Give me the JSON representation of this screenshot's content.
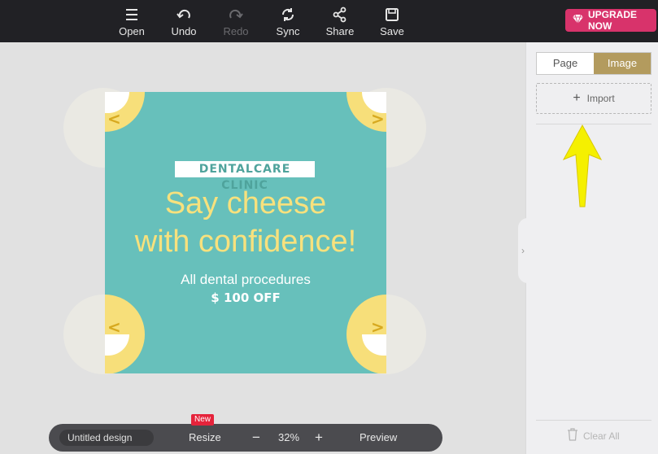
{
  "toolbar": {
    "open_label": "Open",
    "undo_label": "Undo",
    "redo_label": "Redo",
    "sync_label": "Sync",
    "share_label": "Share",
    "save_label": "Save",
    "upgrade_label": "UPGRADE NOW"
  },
  "design": {
    "clinic_name": "DENTALCARE CLINIC",
    "headline_line1": "Say cheese",
    "headline_line2": "with confidence!",
    "subline": "All dental procedures",
    "price": "$ 100 OFF",
    "background_color": "#67c0bb",
    "smiley_color": "#f7df7a"
  },
  "bottom_bar": {
    "title": "Untitled design",
    "resize_label": "Resize",
    "new_badge": "New",
    "zoom_out": "−",
    "zoom": "32%",
    "zoom_in": "+",
    "preview_label": "Preview"
  },
  "panel": {
    "tabs": [
      "Page",
      "Image"
    ],
    "active_tab": "Image",
    "import_label": "Import",
    "clear_all_label": "Clear All"
  },
  "colors": {
    "toolbar_bg": "#212125",
    "accent_pink": "#d8336b",
    "tab_active": "#b39b5e",
    "annotation_arrow": "#f5f000"
  }
}
